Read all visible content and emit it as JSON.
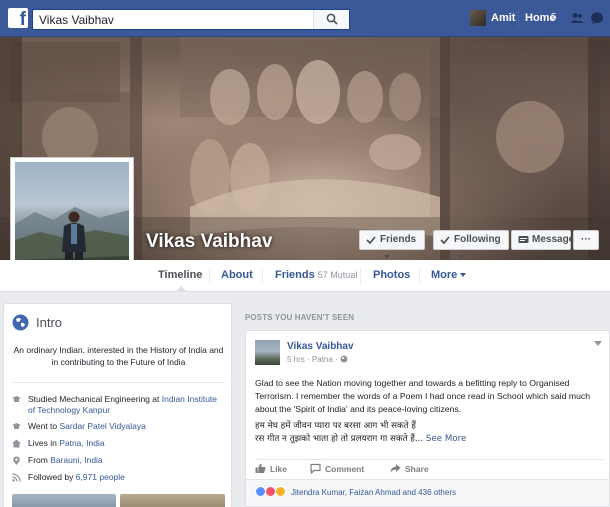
{
  "topbar": {
    "logo": "f",
    "search_value": "Vikas Vaibhav",
    "user_name": "Amit",
    "home_label": "Home",
    "home_count": "5",
    "colors": {
      "bar": "#3b5998"
    }
  },
  "cover": {
    "name": "Vikas Vaibhav",
    "buttons": {
      "friends": "Friends",
      "following": "Following",
      "message": "Message",
      "more": "···"
    }
  },
  "nav": {
    "timeline": "Timeline",
    "about": "About",
    "friends": "Friends",
    "friends_mutual": "57 Mutual",
    "photos": "Photos",
    "more": "More"
  },
  "intro": {
    "title": "Intro",
    "bio": "An ordinary Indian, interested in the History of India and in contributing to the Future of India",
    "items": [
      {
        "icon": "education-icon",
        "prefix": "Studied Mechanical Engineering at ",
        "link": "Indian Institute of Technology Kanpur"
      },
      {
        "icon": "education-icon",
        "prefix": "Went to ",
        "link": "Sardar Patel Vidyalaya"
      },
      {
        "icon": "home-icon",
        "prefix": "Lives in ",
        "link": "Patna, India"
      },
      {
        "icon": "location-pin-icon",
        "prefix": "From ",
        "link": "Barauni, India"
      },
      {
        "icon": "rss-icon",
        "prefix": "Followed by ",
        "link": "6,971 people"
      }
    ]
  },
  "posts": {
    "header": "POSTS YOU HAVEN'T SEEN",
    "post": {
      "author": "Vikas Vaibhav",
      "time": "5 hrs",
      "location": "Patna",
      "text": "Glad to see the Nation moving together and towards a befitting reply to Organised Terrorism. I remember the words of a Poem I had once read in School which said much about the 'Spirit of India' and its peace-loving citizens.",
      "hindi_line1": "हम मेघ हमें जीवन प्यारा पर बरसा आग भी सकते हैं",
      "hindi_line2": "रस गीत न तुझको भाता हो तो प्रलयराग गा सकते हैं...",
      "see_more": "See More",
      "actions": {
        "like": "Like",
        "comment": "Comment",
        "share": "Share"
      },
      "reactions_text": "Jitendra Kumar, Faizan Ahmad and 436 others"
    }
  }
}
